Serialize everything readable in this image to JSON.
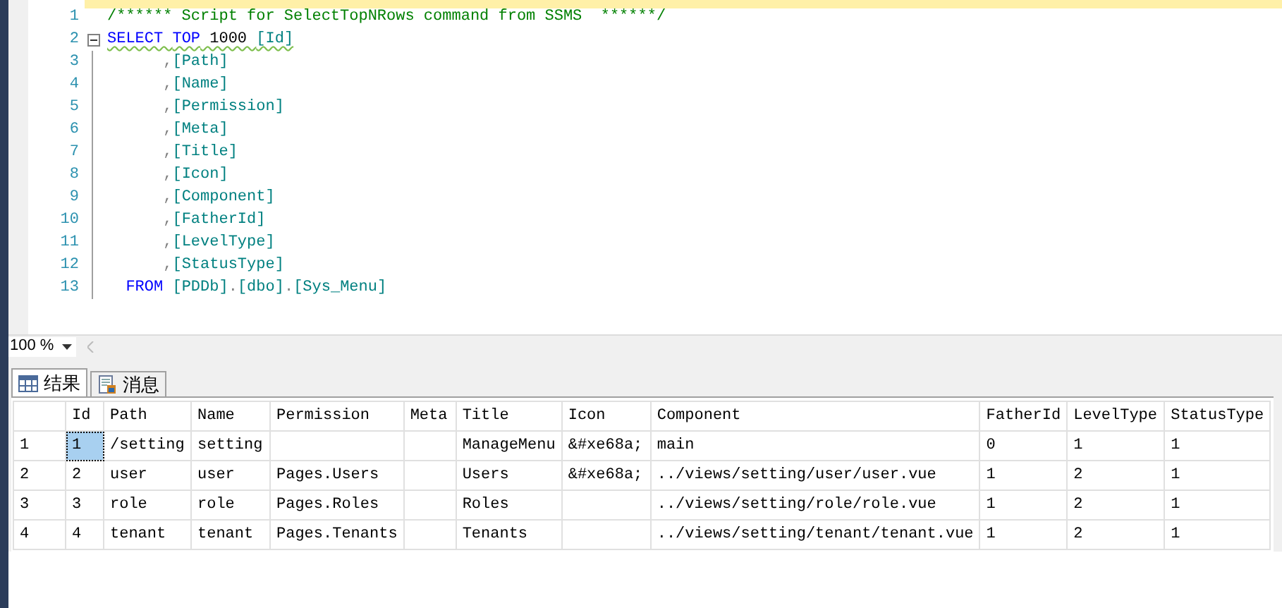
{
  "editor": {
    "lines": [
      {
        "number": "1",
        "tokens": [
          {
            "kind": "comment",
            "text": "/****** Script for SelectTopNRows command from SSMS  ******/"
          }
        ]
      },
      {
        "number": "2",
        "collapsible": true,
        "squiggle": true,
        "tokens": [
          {
            "kind": "keyword",
            "text": "SELECT "
          },
          {
            "kind": "keyword",
            "text": "TOP"
          },
          {
            "kind": "plain",
            "text": " 1000 "
          },
          {
            "kind": "ident",
            "text": "[Id]"
          }
        ]
      },
      {
        "number": "3",
        "tokens": [
          {
            "kind": "punct",
            "text": "      ,"
          },
          {
            "kind": "ident",
            "text": "[Path]"
          }
        ]
      },
      {
        "number": "4",
        "tokens": [
          {
            "kind": "punct",
            "text": "      ,"
          },
          {
            "kind": "ident",
            "text": "[Name]"
          }
        ]
      },
      {
        "number": "5",
        "tokens": [
          {
            "kind": "punct",
            "text": "      ,"
          },
          {
            "kind": "ident",
            "text": "[Permission]"
          }
        ]
      },
      {
        "number": "6",
        "tokens": [
          {
            "kind": "punct",
            "text": "      ,"
          },
          {
            "kind": "ident",
            "text": "[Meta]"
          }
        ]
      },
      {
        "number": "7",
        "tokens": [
          {
            "kind": "punct",
            "text": "      ,"
          },
          {
            "kind": "ident",
            "text": "[Title]"
          }
        ]
      },
      {
        "number": "8",
        "tokens": [
          {
            "kind": "punct",
            "text": "      ,"
          },
          {
            "kind": "ident",
            "text": "[Icon]"
          }
        ]
      },
      {
        "number": "9",
        "tokens": [
          {
            "kind": "punct",
            "text": "      ,"
          },
          {
            "kind": "ident",
            "text": "[Component]"
          }
        ]
      },
      {
        "number": "10",
        "tokens": [
          {
            "kind": "punct",
            "text": "      ,"
          },
          {
            "kind": "ident",
            "text": "[FatherId]"
          }
        ]
      },
      {
        "number": "11",
        "tokens": [
          {
            "kind": "punct",
            "text": "      ,"
          },
          {
            "kind": "ident",
            "text": "[LevelType]"
          }
        ]
      },
      {
        "number": "12",
        "tokens": [
          {
            "kind": "punct",
            "text": "      ,"
          },
          {
            "kind": "ident",
            "text": "[StatusType]"
          }
        ]
      },
      {
        "number": "13",
        "tokens": [
          {
            "kind": "keyword",
            "text": "  FROM "
          },
          {
            "kind": "ident",
            "text": "[PDDb]"
          },
          {
            "kind": "punct",
            "text": "."
          },
          {
            "kind": "ident",
            "text": "[dbo]"
          },
          {
            "kind": "punct",
            "text": "."
          },
          {
            "kind": "ident",
            "text": "[Sys_Menu]"
          }
        ]
      }
    ]
  },
  "zoom": {
    "value": "100 %"
  },
  "tabs": [
    {
      "label": "结果",
      "kind": "grid",
      "selected": true
    },
    {
      "label": "消息",
      "kind": "message",
      "selected": false
    }
  ],
  "results": {
    "columns": [
      "Id",
      "Path",
      "Name",
      "Permission",
      "Meta",
      "Title",
      "Icon",
      "Component",
      "FatherId",
      "LevelType",
      "StatusType"
    ],
    "rows": [
      {
        "number": "1",
        "cells": [
          "1",
          "/setting",
          "setting",
          "",
          "",
          "ManageMenu",
          "&#xe68a;",
          "main",
          "0",
          "1",
          "1"
        ],
        "selected": [
          true,
          false,
          false,
          false,
          false,
          false,
          false,
          false,
          false,
          false,
          false
        ]
      },
      {
        "number": "2",
        "cells": [
          "2",
          "user",
          "user",
          "Pages.Users",
          "",
          "Users",
          "&#xe68a;",
          "../views/setting/user/user.vue",
          "1",
          "2",
          "1"
        ]
      },
      {
        "number": "3",
        "cells": [
          "3",
          "role",
          "role",
          "Pages.Roles",
          "",
          "Roles",
          "",
          "../views/setting/role/role.vue",
          "1",
          "2",
          "1"
        ]
      },
      {
        "number": "4",
        "cells": [
          "4",
          "tenant",
          "tenant",
          "Pages.Tenants",
          "",
          "Tenants",
          "",
          "../views/setting/tenant/tenant.vue",
          "1",
          "2",
          "1"
        ]
      }
    ]
  }
}
